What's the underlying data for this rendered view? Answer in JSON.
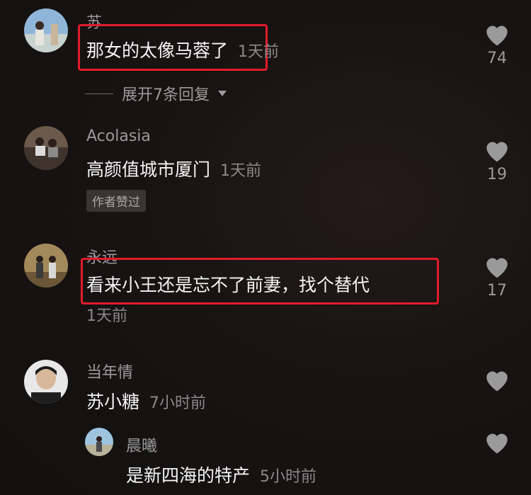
{
  "comments": [
    {
      "name": "苏",
      "text": "那女的太像马蓉了",
      "time": "1天前",
      "likes": "74",
      "expand": "展开7条回复"
    },
    {
      "name": "Acolasia",
      "text": "高颜值城市厦门",
      "time": "1天前",
      "likes": "19",
      "badge": "作者赞过"
    },
    {
      "name": "永远",
      "text": "看来小王还是忘不了前妻，找个替代",
      "time": "1天前",
      "likes": "17"
    },
    {
      "name": "当年情",
      "text": "苏小糖",
      "time": "7小时前"
    }
  ],
  "reply": {
    "name": "晨曦",
    "text": "是新四海的特产",
    "time": "5小时前"
  },
  "colors": {
    "highlight": "#e21b2a",
    "background": "#151312"
  },
  "icons": {
    "like": "heart-icon",
    "expand": "triangle-down-icon"
  }
}
